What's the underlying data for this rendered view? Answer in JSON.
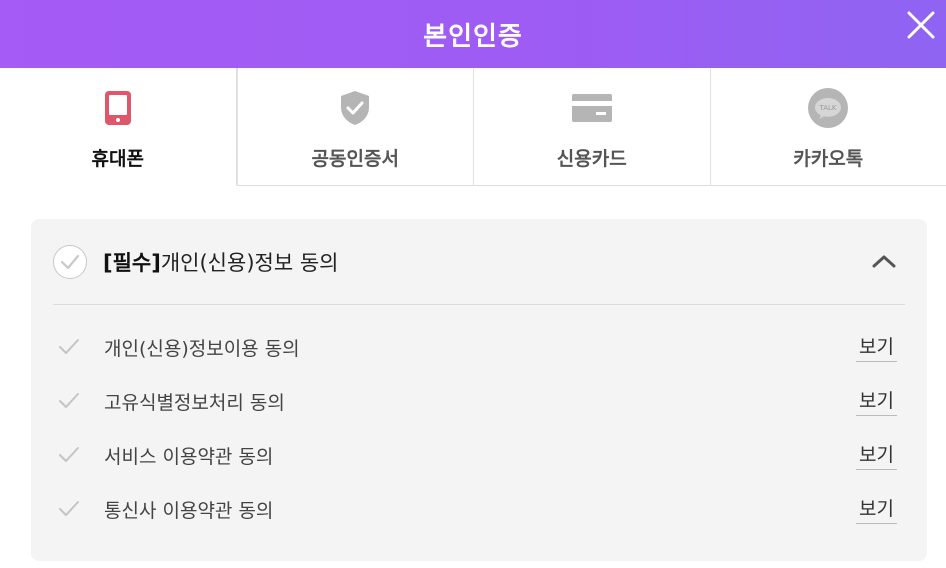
{
  "header": {
    "title": "본인인증"
  },
  "tabs": [
    {
      "label": "휴대폰",
      "icon": "phone-icon",
      "active": true
    },
    {
      "label": "공동인증서",
      "icon": "shield-check-icon",
      "active": false
    },
    {
      "label": "신용카드",
      "icon": "credit-card-icon",
      "active": false
    },
    {
      "label": "카카오톡",
      "icon": "kakao-talk-icon",
      "active": false,
      "icon_text": "TALK"
    }
  ],
  "agreement": {
    "required_tag": "[필수]",
    "all_label": "개인(신용)정보 동의",
    "items": [
      {
        "label": "개인(신용)정보이용 동의",
        "link": "보기"
      },
      {
        "label": "고유식별정보처리 동의",
        "link": "보기"
      },
      {
        "label": "서비스 이용약관 동의",
        "link": "보기"
      },
      {
        "label": "통신사 이용약관 동의",
        "link": "보기"
      }
    ]
  },
  "colors": {
    "header_gradient_start": "#a55bf5",
    "header_gradient_end": "#8f64f2",
    "phone_icon": "#e0566a",
    "inactive_icon": "#b5b5b5"
  }
}
